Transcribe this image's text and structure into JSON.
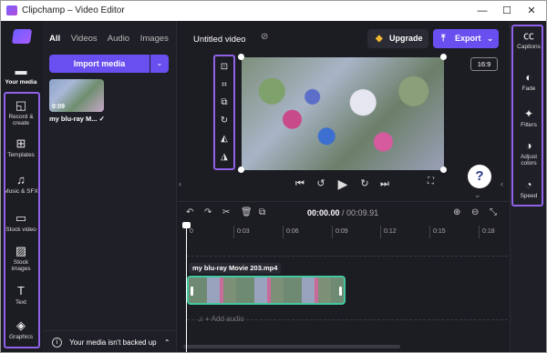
{
  "window": {
    "title": "Clipchamp – Video Editor",
    "controls": {
      "minimize": "—",
      "maximize": "☐",
      "close": "✕"
    }
  },
  "rail": {
    "items": [
      {
        "label": "Your media",
        "icon": "folder-icon",
        "glyph": "▬"
      },
      {
        "label": "Record & create",
        "icon": "camera-icon",
        "glyph": "◱"
      },
      {
        "label": "Templates",
        "icon": "grid-icon",
        "glyph": "⊞"
      },
      {
        "label": "Music & SFX",
        "icon": "music-icon",
        "glyph": "♫"
      },
      {
        "label": "Stock video",
        "icon": "film-icon",
        "glyph": "▭"
      },
      {
        "label": "Stock images",
        "icon": "image-icon",
        "glyph": "▨"
      },
      {
        "label": "Text",
        "icon": "text-icon",
        "glyph": "T"
      },
      {
        "label": "Graphics",
        "icon": "shapes-icon",
        "glyph": "◈"
      }
    ]
  },
  "media": {
    "tabs": [
      "All",
      "Videos",
      "Audio",
      "Images"
    ],
    "import_label": "Import media",
    "import_caret": "⌄",
    "item": {
      "duration": "0:09",
      "title": "my blu-ray M...",
      "check": "✓"
    },
    "backup_notice": "Your media isn't backed up",
    "backup_info": "i",
    "backup_chevron": "⌃"
  },
  "topbar": {
    "project_title": "Untitled video",
    "cloud_icon": "⊘",
    "upgrade_label": "Upgrade",
    "upgrade_glyph": "◆",
    "export_label": "Export",
    "export_glyph": "⤒",
    "export_caret": "⌄"
  },
  "preview": {
    "tools": [
      {
        "name": "fit-icon",
        "glyph": "⊡"
      },
      {
        "name": "crop-icon",
        "glyph": "⌗"
      },
      {
        "name": "pip-icon",
        "glyph": "⧉"
      },
      {
        "name": "rotate-icon",
        "glyph": "↻"
      },
      {
        "name": "flip-horizontal-icon",
        "glyph": "◭"
      },
      {
        "name": "flip-vertical-icon",
        "glyph": "◮"
      }
    ],
    "aspect_ratio": "16:9",
    "help": "?",
    "playback": {
      "prev": "⏮",
      "back5": "↺",
      "play": "▶",
      "fwd5": "↻",
      "next": "⏭",
      "fullscreen": "⛶"
    },
    "collapse_left": "‹",
    "collapse_right": "‹",
    "collapse_down": "⌄"
  },
  "right_panel": {
    "items": [
      {
        "label": "Captions",
        "icon": "captions-icon",
        "glyph": "㏄"
      },
      {
        "label": "Fade",
        "icon": "fade-icon",
        "glyph": "◐"
      },
      {
        "label": "Filters",
        "icon": "filters-icon",
        "glyph": "✦"
      },
      {
        "label": "Adjust colors",
        "icon": "adjust-colors-icon",
        "glyph": "◑"
      },
      {
        "label": "Speed",
        "icon": "speed-icon",
        "glyph": "◔"
      }
    ]
  },
  "timeline": {
    "tools": [
      {
        "name": "undo-icon",
        "glyph": "↶"
      },
      {
        "name": "redo-icon",
        "glyph": "↷"
      },
      {
        "name": "split-icon",
        "glyph": "✂"
      },
      {
        "name": "delete-icon",
        "glyph": "🗑"
      },
      {
        "name": "duplicate-icon",
        "glyph": "⧉"
      }
    ],
    "current_time": "00:00.00",
    "total_time": "/ 00:09.91",
    "zoom_in": "⊕",
    "zoom_out": "⊖",
    "fit": "⤡",
    "ticks": [
      "0",
      "0:03",
      "0:06",
      "0:09",
      "0:12",
      "0:15",
      "0:18"
    ],
    "clip_title": "my blu-ray Movie 203.mp4",
    "add_audio": "♫ + Add audio"
  }
}
